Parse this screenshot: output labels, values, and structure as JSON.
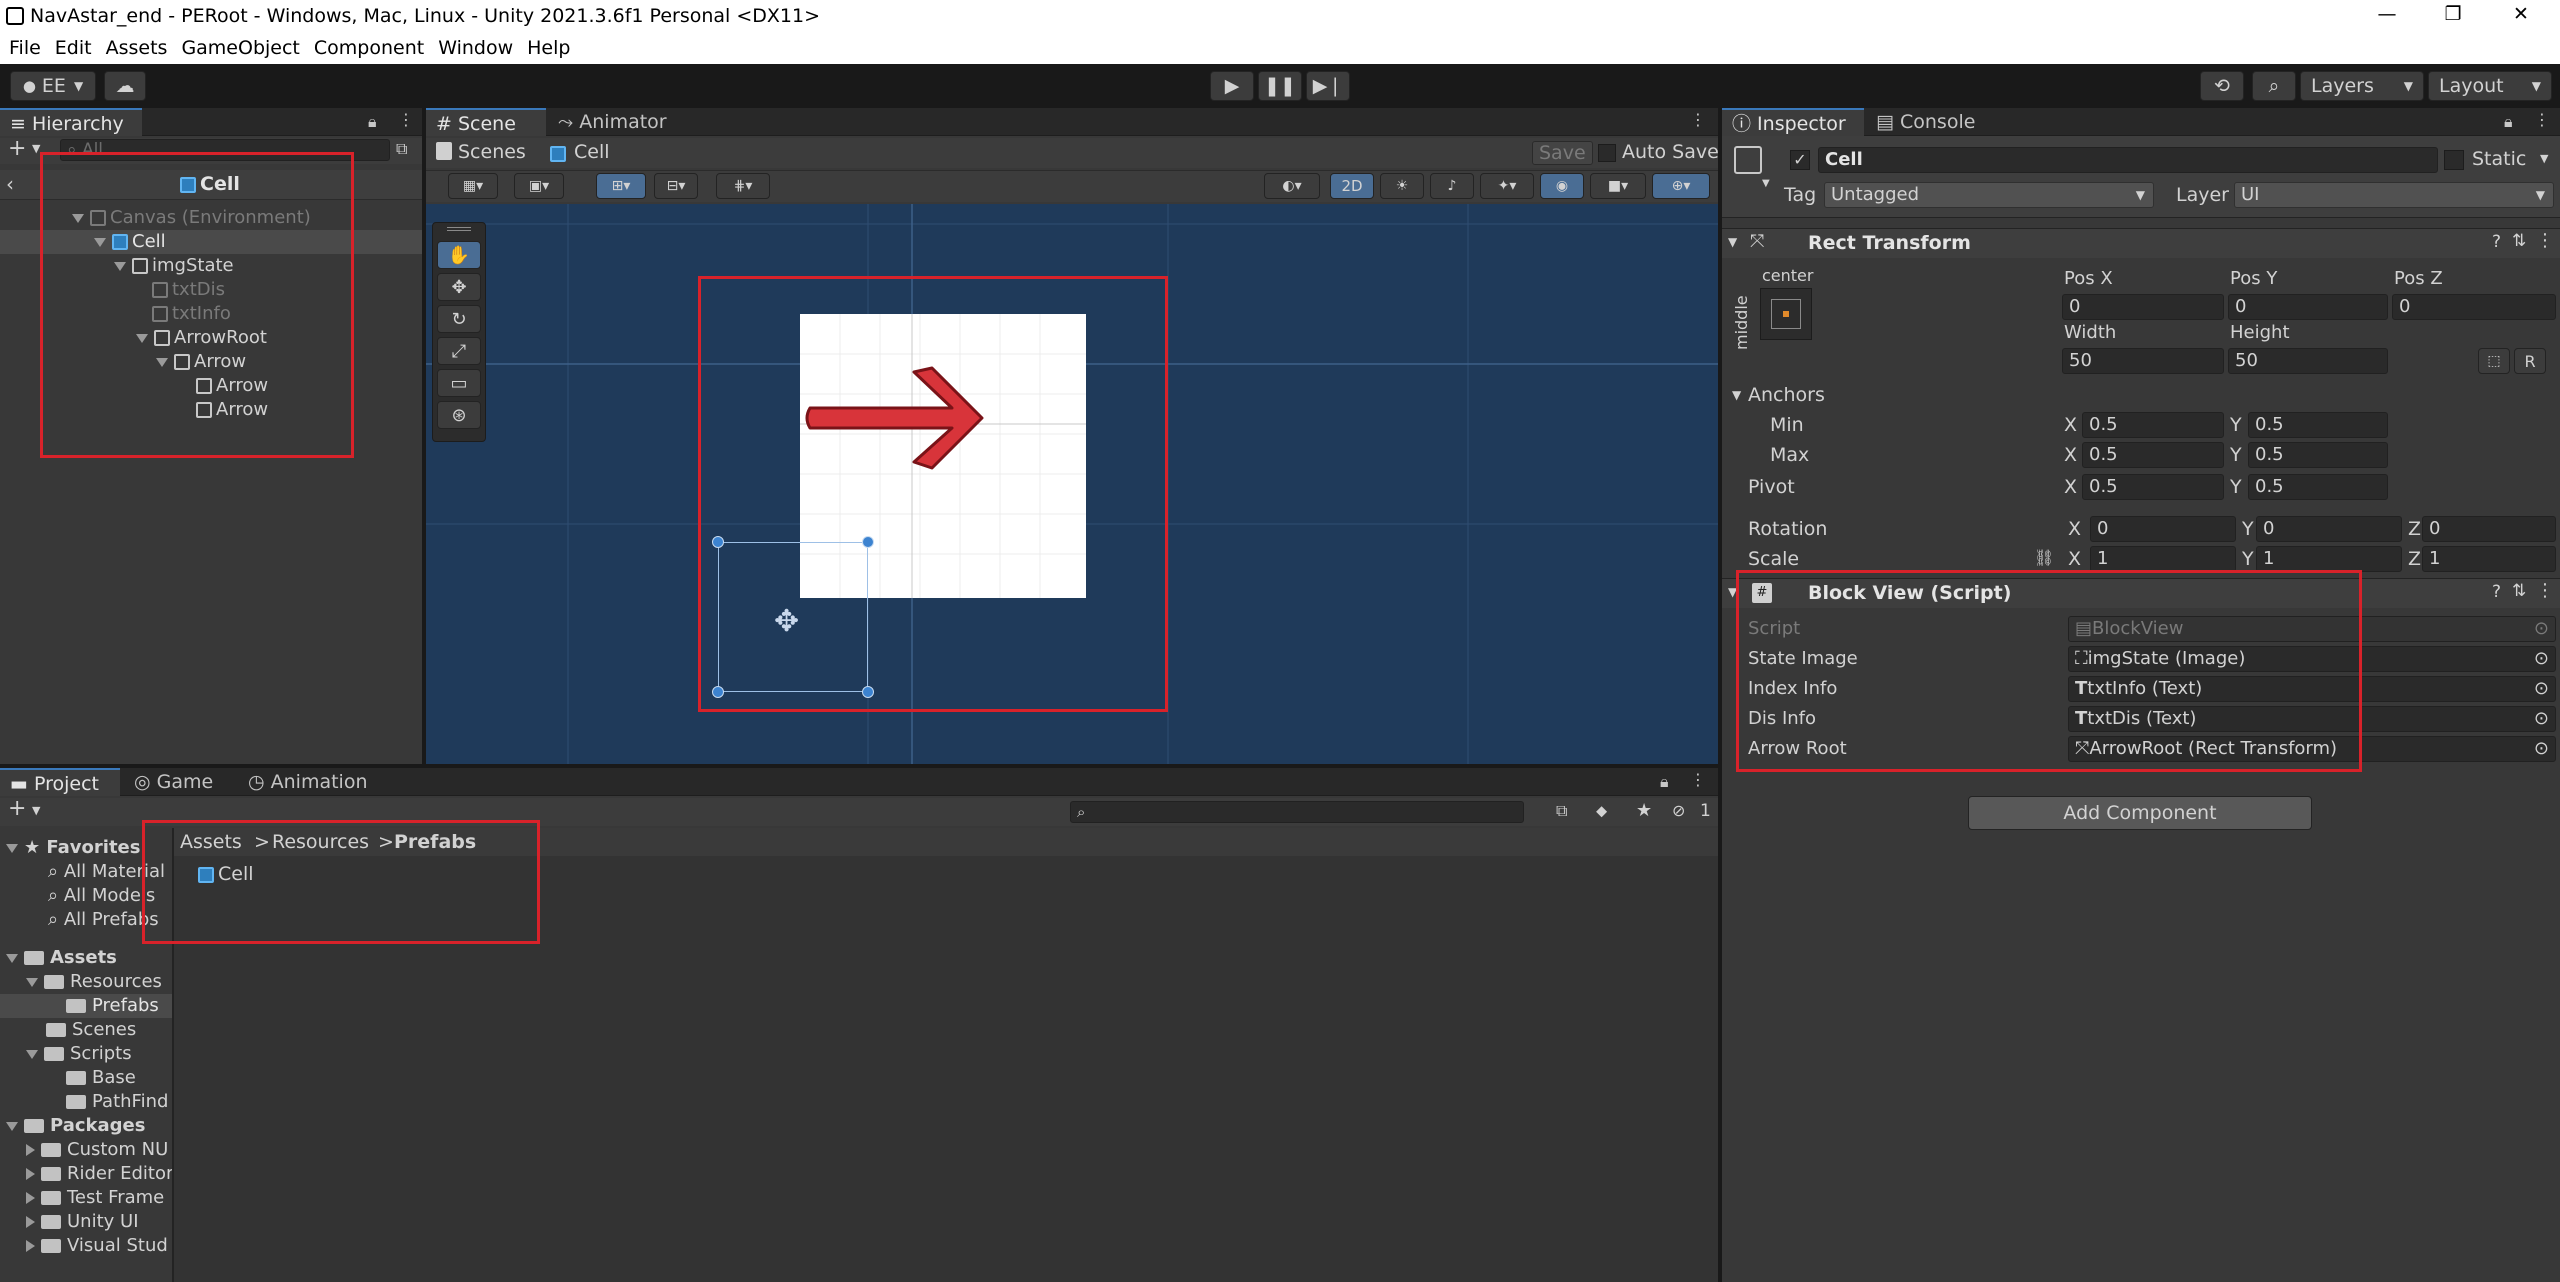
{
  "window": {
    "title": "NavAstar_end - PERoot - Windows, Mac, Linux - Unity 2021.3.6f1 Personal <DX11>",
    "controls": [
      "—",
      "❐",
      "✕"
    ]
  },
  "menu": [
    "File",
    "Edit",
    "Assets",
    "GameObject",
    "Component",
    "Window",
    "Help"
  ],
  "toolbar": {
    "account": "EE",
    "layers": "Layers",
    "layout": "Layout"
  },
  "hierarchy": {
    "tab": "Hierarchy",
    "search_placeholder": "All",
    "header": "Cell",
    "items": [
      {
        "label": "Canvas (Environment)"
      },
      {
        "label": "Cell"
      },
      {
        "label": "imgState"
      },
      {
        "label": "txtDis"
      },
      {
        "label": "txtInfo"
      },
      {
        "label": "ArrowRoot"
      },
      {
        "label": "Arrow"
      },
      {
        "label": "Arrow"
      },
      {
        "label": "Arrow"
      }
    ]
  },
  "scene": {
    "tabs": [
      "Scene",
      "Animator"
    ],
    "breadcrumb": [
      "Scenes",
      "Cell"
    ],
    "save": "Save",
    "auto_save": "Auto Save",
    "mode_2d": "2D"
  },
  "project": {
    "tabs": [
      "Project",
      "Game",
      "Animation"
    ],
    "hidden_count": "1",
    "favorites_label": "Favorites",
    "favorites": [
      "All Material",
      "All Models",
      "All Prefabs"
    ],
    "assets_label": "Assets",
    "assets": [
      "Resources",
      "Prefabs",
      "Scenes",
      "Scripts",
      "Base",
      "PathFind"
    ],
    "packages_label": "Packages",
    "packages": [
      "Custom NU",
      "Rider Editor",
      "Test Frame",
      "Unity UI",
      "Visual Stud"
    ],
    "breadcrumb": [
      "Assets",
      "Resources",
      "Prefabs"
    ],
    "files": [
      "Cell"
    ]
  },
  "inspector": {
    "tabs": [
      "Inspector",
      "Console"
    ],
    "object_name": "Cell",
    "static_label": "Static",
    "tag_label": "Tag",
    "tag_value": "Untagged",
    "layer_label": "Layer",
    "layer_value": "UI",
    "rect_transform": {
      "title": "Rect Transform",
      "anchor_h": "center",
      "anchor_v": "middle",
      "pos_x_label": "Pos X",
      "pos_x": "0",
      "pos_y_label": "Pos Y",
      "pos_y": "0",
      "pos_z_label": "Pos Z",
      "pos_z": "0",
      "width_label": "Width",
      "width": "50",
      "height_label": "Height",
      "height": "50",
      "r_button": "R",
      "anchors_label": "Anchors",
      "min_label": "Min",
      "min_x": "0.5",
      "min_y": "0.5",
      "max_label": "Max",
      "max_x": "0.5",
      "max_y": "0.5",
      "pivot_label": "Pivot",
      "pivot_x": "0.5",
      "pivot_y": "0.5",
      "rotation_label": "Rotation",
      "rot_x": "0",
      "rot_y": "0",
      "rot_z": "0",
      "scale_label": "Scale",
      "scale_x": "1",
      "scale_y": "1",
      "scale_z": "1",
      "x": "X",
      "y": "Y",
      "z": "Z"
    },
    "block_view": {
      "title": "Block View (Script)",
      "script_label": "Script",
      "script_value": "BlockView",
      "state_image_label": "State Image",
      "state_image_value": "imgState (Image)",
      "index_info_label": "Index Info",
      "index_info_value": "txtInfo (Text)",
      "dis_info_label": "Dis Info",
      "dis_info_value": "txtDis (Text)",
      "arrow_root_label": "Arrow Root",
      "arrow_root_value": "ArrowRoot (Rect Transform)"
    },
    "add_component": "Add Component"
  },
  "colors": {
    "highlight": "#d8222a",
    "scene_bg": "#1f3a5a",
    "accent": "#3a79bb"
  }
}
